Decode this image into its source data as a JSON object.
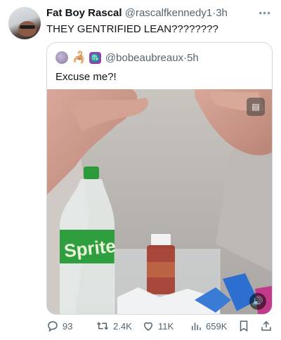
{
  "tweet": {
    "author_name": "Fat Boy Rascal",
    "author_handle": "@rascalfkennedy1",
    "separator": "·",
    "time": "3h",
    "text": "THEY GENTRIFIED LEAN????????",
    "more_icon": "ellipsis-icon"
  },
  "quoted": {
    "handle": "@bobeaubreaux",
    "separator": "·",
    "time": "5h",
    "text": "Excuse me?!",
    "badge_icons": [
      "scorpion-emoji",
      "scorpio-sign-emoji"
    ],
    "scorpio_glyph": "♏",
    "media": {
      "alt_icon": "image-description-icon",
      "sound_icon": "speaker-icon",
      "bottle_label_text": "Sprite"
    }
  },
  "actions": {
    "replies": "93",
    "reposts": "2.4K",
    "likes": "11K",
    "views": "659K"
  }
}
